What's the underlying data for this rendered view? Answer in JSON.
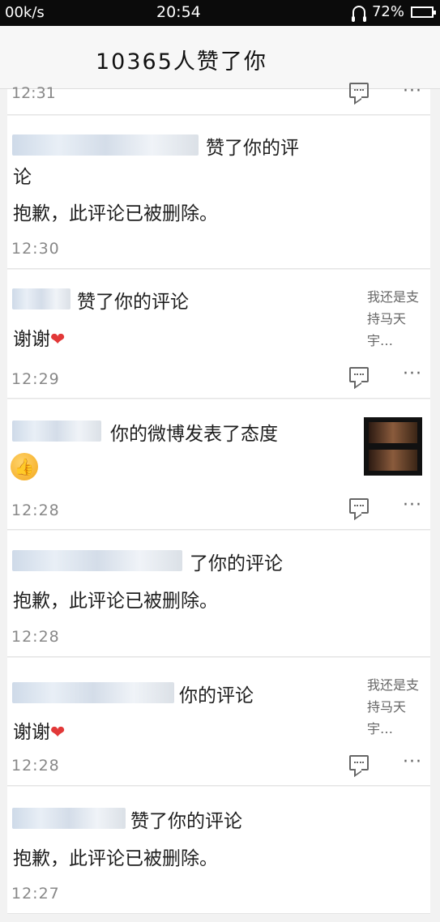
{
  "status_bar": {
    "network_speed": "00k/s",
    "time": "20:54",
    "battery": "72%"
  },
  "header": {
    "title": "10365人赞了你"
  },
  "items": [
    {
      "time": "12:31"
    },
    {
      "name_tail": "…",
      "action": "赞了你的评",
      "action_cont": "论",
      "body": "抱歉，此评论已被删除。",
      "time": "12:30"
    },
    {
      "action": "赞了你的评论",
      "body": "谢谢",
      "side_text": "我还是支持马天宇…",
      "time": "12:29"
    },
    {
      "action": "你的微博发表了态度",
      "time": "12:28"
    },
    {
      "action": "了你的评论",
      "body": "抱歉，此评论已被删除。",
      "time": "12:28"
    },
    {
      "action": "你的评论",
      "body": "谢谢",
      "side_text": "我还是支持马天宇…",
      "time": "12:28"
    },
    {
      "action": "赞了你的评论",
      "body": "抱歉，此评论已被删除。",
      "time": "12:27"
    }
  ],
  "icons": {
    "comment": "comment-icon",
    "more": "more-icon",
    "like": "thumbs-up-icon",
    "heart": "heart-icon"
  },
  "colors": {
    "battery_fill": "#37c837",
    "heart": "#e23838",
    "like_badge": "#f3a81c"
  }
}
